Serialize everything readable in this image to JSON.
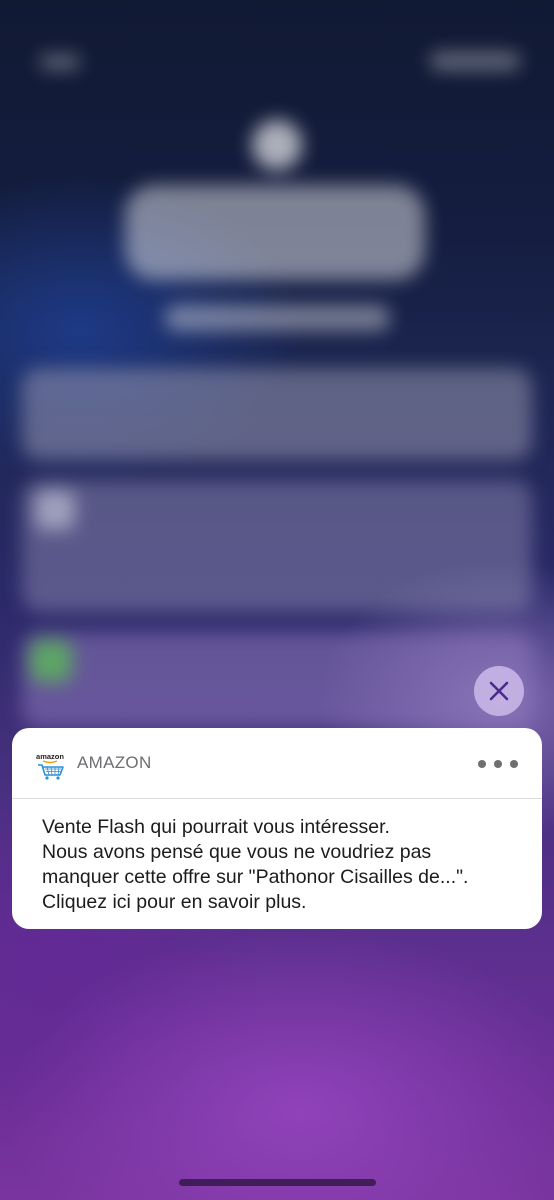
{
  "notification": {
    "app_name": "AMAZON",
    "app_icon": "amazon-cart-icon",
    "app_icon_text": "amazon",
    "lines": [
      "Vente Flash qui pourrait vous intéresser.",
      "Nous avons pensé que vous ne voudriez pas",
      "manquer cette offre sur \"Pathonor Cisailles de...\".",
      "Cliquez ici pour en savoir plus."
    ],
    "more_icon": "ellipsis-icon"
  },
  "controls": {
    "close_icon": "close-icon"
  },
  "colors": {
    "close_button_bg": "#c8b4e6",
    "close_icon": "#4a2a8a",
    "card_bg": "#ffffff",
    "amazon_orange": "#f39c12",
    "amazon_cart_blue": "#2d8fd5"
  }
}
